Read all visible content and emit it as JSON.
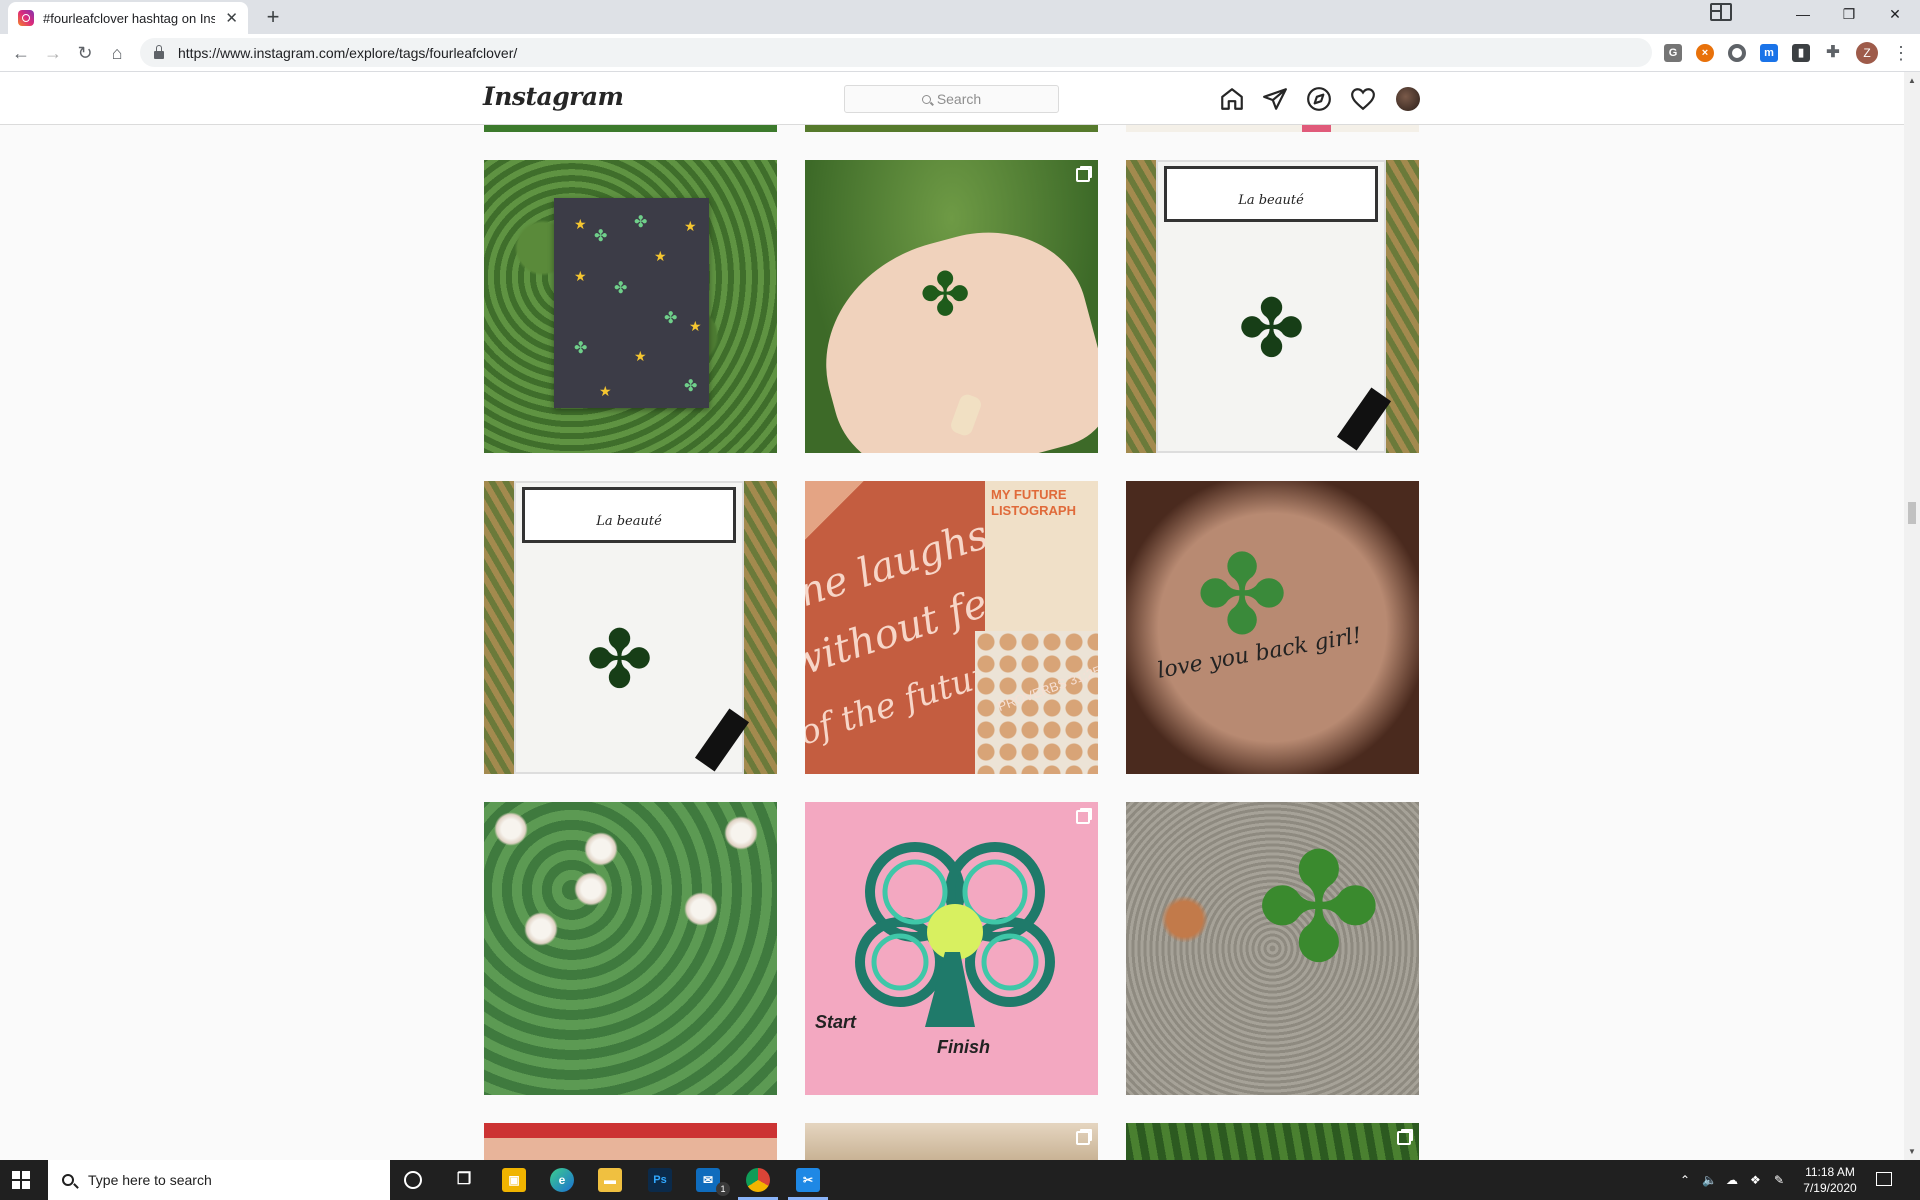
{
  "browser": {
    "tab_title": "#fourleafclover hashtag on Instag",
    "url": "https://www.instagram.com/explore/tags/fourleafclover/",
    "profile_initial": "Z"
  },
  "instagram": {
    "logo": "Instagram",
    "search_placeholder": "Search",
    "posts": [
      {
        "id": "clover-star-card",
        "multi": false
      },
      {
        "id": "clover-in-hand",
        "multi": true
      },
      {
        "id": "la-beaute-package-1",
        "multi": false,
        "band_text": "La beauté"
      },
      {
        "id": "la-beaute-package-2",
        "multi": false,
        "band_text": "La beauté"
      },
      {
        "id": "shirt-proverbs",
        "multi": false,
        "shirt_line1": "ne laughs",
        "shirt_line2": "without fe",
        "shirt_line3": "of the future",
        "book_line1": "MY FUTURE",
        "book_line2": "LISTOGRAPH",
        "verse": "PROVERBS 31:25"
      },
      {
        "id": "clover-tattoo",
        "multi": false,
        "tattoo_text": "love you back girl!"
      },
      {
        "id": "clover-patch",
        "multi": false
      },
      {
        "id": "clover-maze",
        "multi": true,
        "start_label": "Start",
        "finish_label": "Finish"
      },
      {
        "id": "clover-on-rock",
        "multi": false
      }
    ]
  },
  "taskbar": {
    "search_placeholder": "Type here to search",
    "time": "11:18 AM",
    "date": "7/19/2020",
    "mail_badge": "1"
  },
  "colors": {
    "ig_border": "#dbdbdb",
    "page_bg": "#fafafa",
    "taskbar_bg": "#202020"
  }
}
